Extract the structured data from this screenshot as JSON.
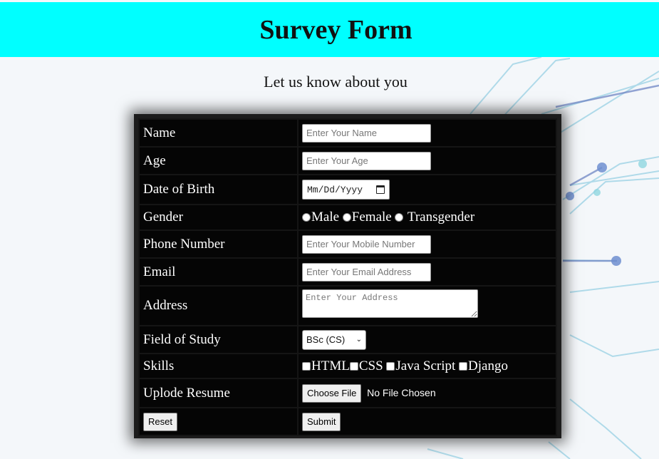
{
  "header": {
    "title": "Survey Form"
  },
  "subtitle": "Let us know about you",
  "colors": {
    "header_bg": "#00ffff",
    "form_bg": "#050505",
    "circuit_line": "#8fc9dd"
  },
  "form": {
    "name": {
      "label": "Name",
      "placeholder": "Enter Your Name"
    },
    "age": {
      "label": "Age",
      "placeholder": "Enter Your Age"
    },
    "dob": {
      "label": "Date of Birth",
      "value": "Mm/Dd/Yyyy"
    },
    "gender": {
      "label": "Gender",
      "options": [
        "Male",
        "Female",
        "Transgender"
      ]
    },
    "phone": {
      "label": "Phone Number",
      "placeholder": "Enter Your Mobile Number"
    },
    "email": {
      "label": "Email",
      "placeholder": "Enter Your Email Address"
    },
    "address": {
      "label": "Address",
      "placeholder": "Enter Your Address"
    },
    "field": {
      "label": "Field of Study",
      "selected": "BSc (CS)"
    },
    "skills": {
      "label": "Skills",
      "options": [
        "HTML",
        "CSS",
        "Java Script",
        "Django"
      ]
    },
    "resume": {
      "label": "Uplode Resume",
      "button": "Choose File",
      "status": "No File Chosen"
    },
    "reset_label": "Reset",
    "submit_label": "Submit"
  }
}
